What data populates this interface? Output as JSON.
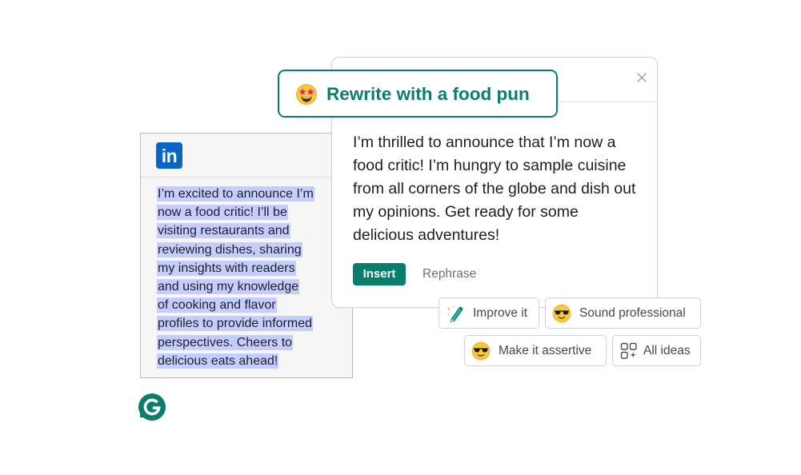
{
  "linkedin_post": {
    "logo_text": "in",
    "lines": [
      "I’m excited to announce I’m",
      "now a food critic! I’ll be",
      "visiting restaurants and",
      "reviewing dishes, sharing",
      "my insights with readers",
      "and using my knowledge",
      "of cooking and flavor",
      "profiles to provide informed",
      "perspectives. Cheers to",
      "delicious eats ahead!"
    ]
  },
  "prompt": {
    "label": "Rewrite with a food pun",
    "emoji": "star-struck-emoji"
  },
  "suggestion": {
    "text": "I’m thrilled to announce that I’m now a food critic! I’m hungry to sample cuisine from all corners of the globe and dish out my opinions. Get ready for some delicious adventures!",
    "insert_label": "Insert",
    "rephrase_label": "Rephrase",
    "close_icon": "close-icon"
  },
  "chips": {
    "improve": {
      "label": "Improve it",
      "icon": "magic-pen-icon"
    },
    "sound_professional": {
      "label": "Sound professional",
      "icon": "sunglasses-emoji"
    },
    "make_assertive": {
      "label": "Make it assertive",
      "icon": "sunglasses-emoji"
    },
    "all_ideas": {
      "label": "All ideas",
      "icon": "grid-sparkle-icon"
    }
  },
  "colors": {
    "brand_green": "#0a7e6a",
    "linkedin_blue": "#0a66c2",
    "highlight": "#c5cdfc"
  }
}
